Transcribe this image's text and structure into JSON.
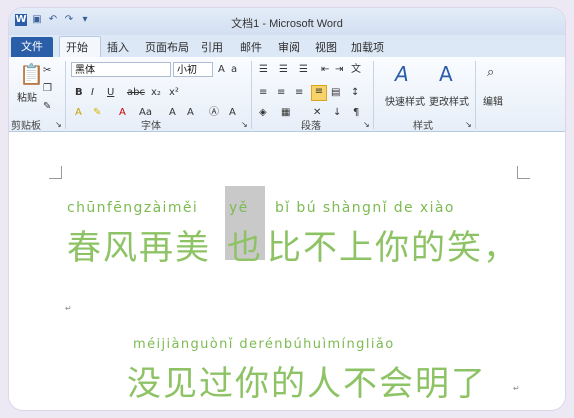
{
  "window": {
    "title": "文档1 - Microsoft Word"
  },
  "tabs": {
    "file": "文件",
    "items": [
      "开始",
      "插入",
      "页面布局",
      "引用",
      "邮件",
      "审阅",
      "视图",
      "加载项"
    ]
  },
  "ribbon": {
    "clipboard": {
      "paste": "粘贴",
      "label": "剪贴板"
    },
    "font": {
      "name": "黑体",
      "size": "小初",
      "label": "字体"
    },
    "paragraph": {
      "label": "段落"
    },
    "styles": {
      "quick": "快速样式",
      "change": "更改样式",
      "label": "样式"
    },
    "editing": {
      "label": "编辑"
    }
  },
  "document": {
    "line1": {
      "pinyin_a": "chūnfēngzàiměi",
      "pinyin_hl": "yě",
      "pinyin_b": "bǐ bú shàngnǐ de xiào",
      "hanzi_a": "春风再美",
      "hanzi_hl": "也",
      "hanzi_b": "比不上你的笑，"
    },
    "line2": {
      "pinyin": "méijiànguònǐ derénbúhuìmíngliǎo",
      "hanzi": "没见过你的人不会明了"
    }
  },
  "colors": {
    "accent": "#2a5ea8",
    "pinyin": "#7dbb52",
    "text": "#8ec365"
  }
}
